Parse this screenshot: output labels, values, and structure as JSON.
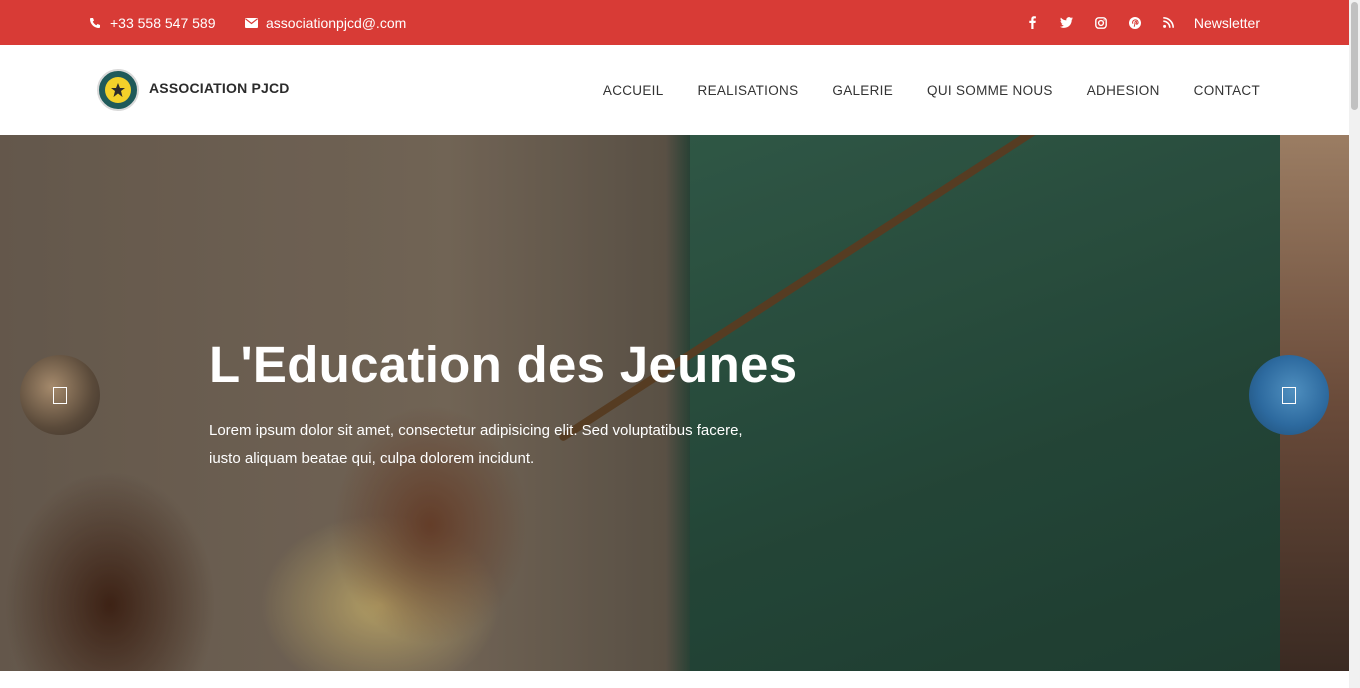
{
  "topbar": {
    "phone": "+33 558 547 589",
    "email": "associationpjcd@.com",
    "social": [
      {
        "icon": "facebook-icon",
        "glyph": "f"
      },
      {
        "icon": "twitter-icon",
        "glyph": "t"
      },
      {
        "icon": "instagram-icon",
        "glyph": "◎"
      },
      {
        "icon": "pinterest-icon",
        "glyph": "p"
      },
      {
        "icon": "rss-icon",
        "glyph": "⌇"
      }
    ],
    "newsletter": "Newsletter",
    "color": "#d83b36"
  },
  "header": {
    "brand": "ASSOCIATION PJCD",
    "nav": [
      "ACCUEIL",
      "REALISATIONS",
      "GALERIE",
      "QUI SOMME NOUS",
      "ADHESION",
      "CONTACT"
    ]
  },
  "hero": {
    "title": "L'Education des Jeunes",
    "description": "Lorem ipsum dolor sit amet, consectetur adipisicing elit. Sed voluptatibus facere, iusto aliquam beatae qui, culpa dolorem incidunt."
  }
}
